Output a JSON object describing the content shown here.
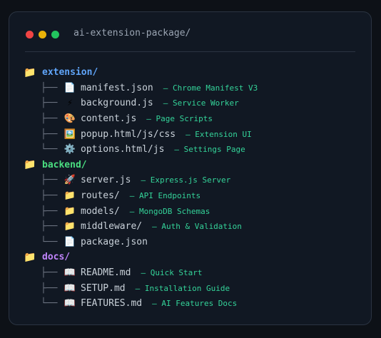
{
  "window": {
    "title": "ai-extension-package/",
    "controls": [
      {
        "name": "close",
        "color": "#ef4444"
      },
      {
        "name": "minimize",
        "color": "#eab308"
      },
      {
        "name": "maximize",
        "color": "#22c55e"
      }
    ]
  },
  "tree": [
    {
      "icon": "📁",
      "name": "extension/",
      "color": "#60a5fa",
      "children": [
        {
          "branch": "├──",
          "icon": "📄",
          "name": "manifest.json",
          "comment": "— Chrome Manifest V3"
        },
        {
          "branch": "├──",
          "icon": "⚡",
          "name": "background.js",
          "comment": "— Service Worker"
        },
        {
          "branch": "├──",
          "icon": "🎨",
          "name": "content.js",
          "comment": "— Page Scripts"
        },
        {
          "branch": "├──",
          "icon": "🖼️",
          "name": "popup.html/js/css",
          "comment": "— Extension UI"
        },
        {
          "branch": "└──",
          "icon": "⚙️",
          "name": "options.html/js",
          "comment": "— Settings Page"
        }
      ]
    },
    {
      "icon": "📁",
      "name": "backend/",
      "color": "#4ade80",
      "children": [
        {
          "branch": "├──",
          "icon": "🚀",
          "name": "server.js",
          "comment": "— Express.js Server"
        },
        {
          "branch": "├──",
          "icon": "📁",
          "name": "routes/",
          "comment": "— API Endpoints"
        },
        {
          "branch": "├──",
          "icon": "📁",
          "name": "models/",
          "comment": "— MongoDB Schemas"
        },
        {
          "branch": "├──",
          "icon": "📁",
          "name": "middleware/",
          "comment": "— Auth & Validation"
        },
        {
          "branch": "└──",
          "icon": "📄",
          "name": "package.json",
          "comment": ""
        }
      ]
    },
    {
      "icon": "📁",
      "name": "docs/",
      "color": "#c084fc",
      "children": [
        {
          "branch": "├──",
          "icon": "📖",
          "name": "README.md",
          "comment": "— Quick Start"
        },
        {
          "branch": "├──",
          "icon": "📖",
          "name": "SETUP.md",
          "comment": "— Installation Guide"
        },
        {
          "branch": "└──",
          "icon": "📖",
          "name": "FEATURES.md",
          "comment": "— AI Features Docs"
        }
      ]
    }
  ]
}
